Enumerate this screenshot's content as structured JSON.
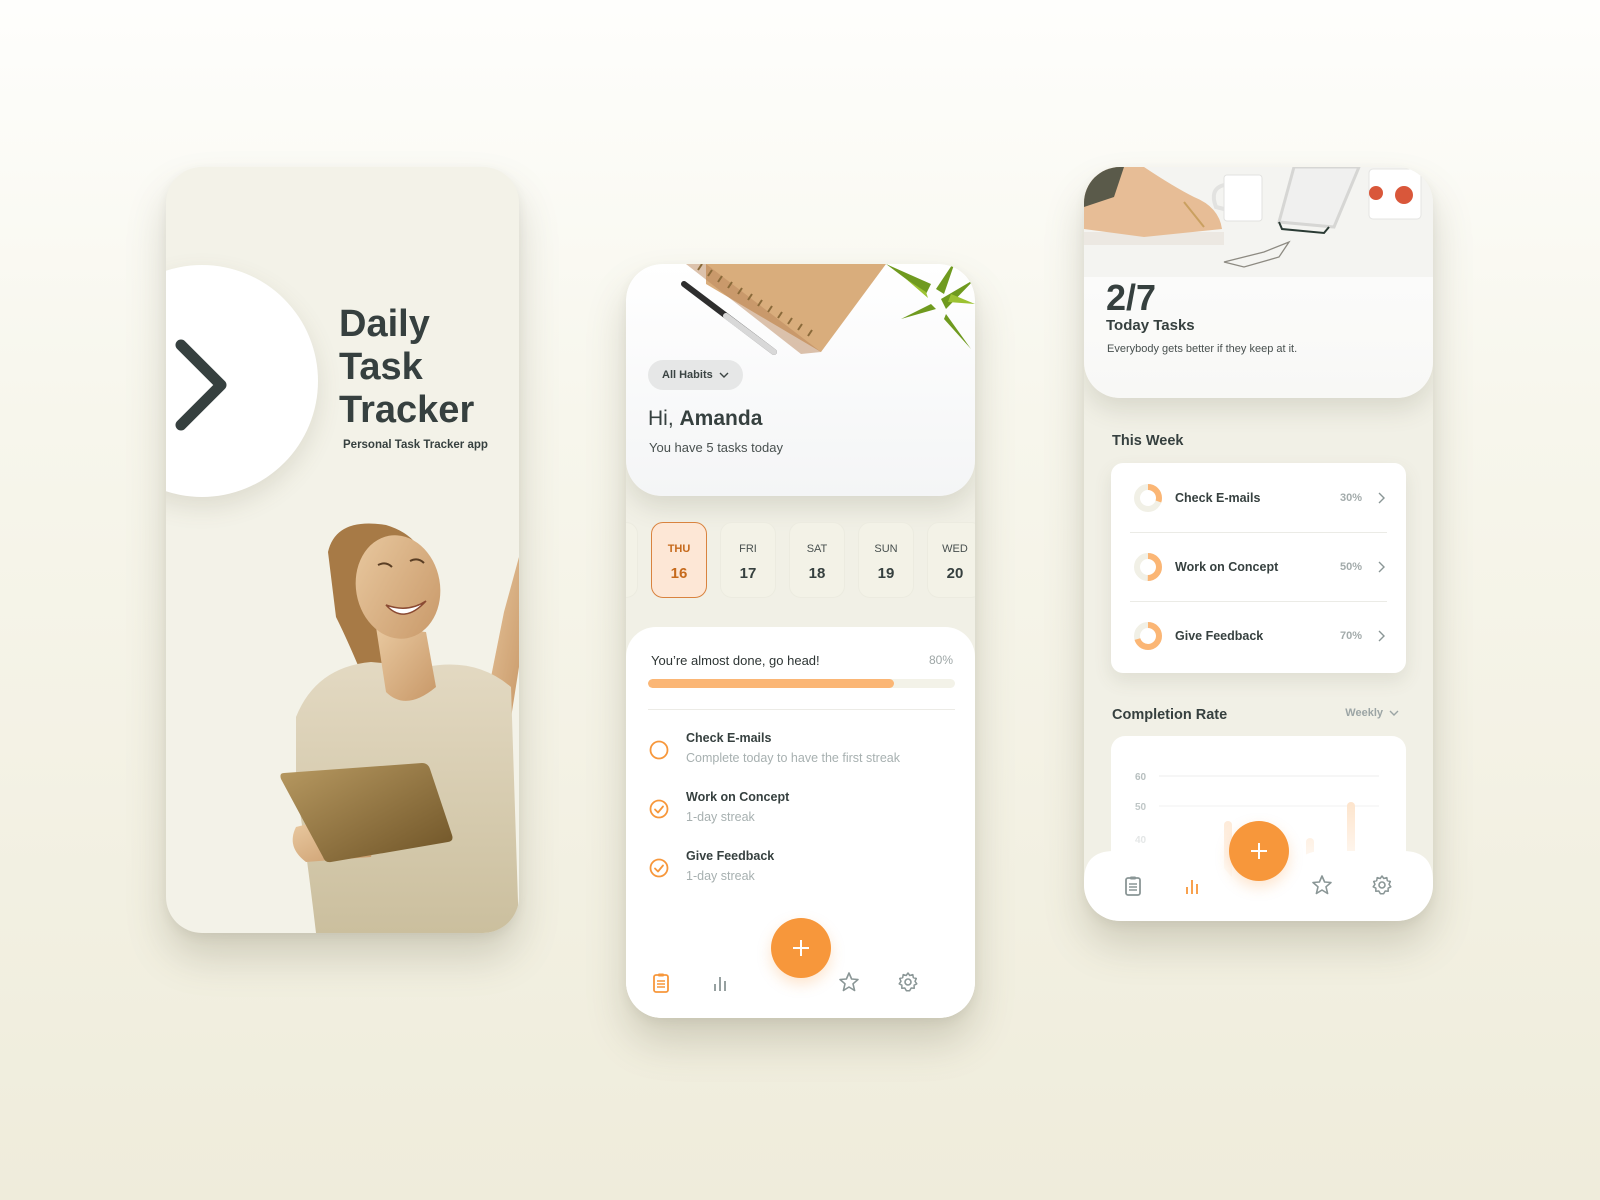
{
  "splash": {
    "title_lines": [
      "Daily",
      "Task",
      "Tracker"
    ],
    "subtitle": "Personal Task Tracker app",
    "next_icon": "chevron-right-icon",
    "illustration": "woman-holding-tablet-photo"
  },
  "home": {
    "filter_label": "All Habits",
    "greeting_prefix": "Hi,",
    "user_name": "Amanda",
    "tasks_summary": "You have 5 tasks today",
    "dates": [
      {
        "dow": "",
        "num": "",
        "state": "partial"
      },
      {
        "dow": "THU",
        "num": "16",
        "state": "active"
      },
      {
        "dow": "FRI",
        "num": "17",
        "state": "normal"
      },
      {
        "dow": "SAT",
        "num": "18",
        "state": "normal"
      },
      {
        "dow": "SUN",
        "num": "19",
        "state": "normal"
      },
      {
        "dow": "WED",
        "num": "20",
        "state": "normal"
      }
    ],
    "progress": {
      "label": "You’re almost done, go head!",
      "percent_text": "80%",
      "value": 0.8
    },
    "tasks": [
      {
        "name": "Check E-mails",
        "subtitle": "Complete today to have the first streak",
        "done": false
      },
      {
        "name": "Work on Concept",
        "subtitle": "1-day streak",
        "done": true
      },
      {
        "name": "Give Feedback",
        "subtitle": "1-day streak",
        "done": true
      }
    ],
    "nav": {
      "items": [
        "tasks",
        "stats",
        "favorites",
        "settings"
      ],
      "active": "tasks",
      "fab_label": "+"
    }
  },
  "stats": {
    "count": "2/7",
    "count_label": "Today Tasks",
    "quote": "Everybody gets better if they keep at it.",
    "week_title": "This Week",
    "week_items": [
      {
        "name": "Check E-mails",
        "percent_text": "30%",
        "value": 0.3
      },
      {
        "name": "Work on Concept",
        "percent_text": "50%",
        "value": 0.5
      },
      {
        "name": "Give Feedback",
        "percent_text": "70%",
        "value": 0.7
      }
    ],
    "completion_title": "Completion Rate",
    "period_select": "Weekly",
    "chart_y_ticks": [
      "60",
      "50",
      "40"
    ],
    "nav": {
      "items": [
        "tasks",
        "stats",
        "favorites",
        "settings"
      ],
      "active": "stats",
      "fab_label": "+"
    }
  },
  "colors": {
    "accent": "#f7973b",
    "accent_light": "#fbb675",
    "active_date_bg": "#fde7d6",
    "active_date_text": "#c66a1c",
    "text_dark": "#36403f",
    "text_muted": "#a7b0b0",
    "icon_gray": "#8a9696"
  }
}
